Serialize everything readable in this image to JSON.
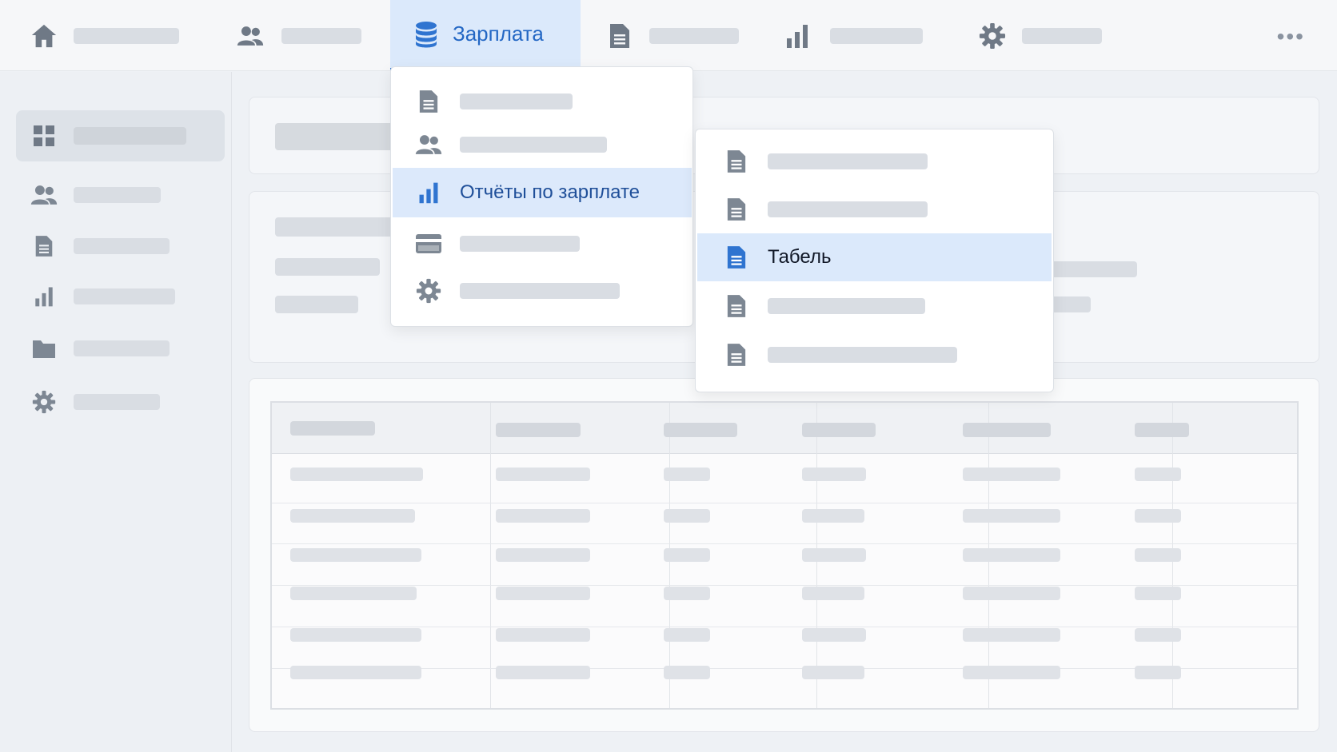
{
  "colors": {
    "accent": "#2f74d0",
    "active_bg": "#dce9fb",
    "icon_gray": "#7d8793",
    "placeholder": "#d9dde3"
  },
  "topnav": {
    "items": [
      {
        "icon": "home-icon",
        "label": ""
      },
      {
        "icon": "users-icon",
        "label": ""
      },
      {
        "icon": "database-icon",
        "label": "Зарплата",
        "active": true
      },
      {
        "icon": "document-icon",
        "label": ""
      },
      {
        "icon": "bar-chart-icon",
        "label": ""
      },
      {
        "icon": "gear-icon",
        "label": ""
      }
    ],
    "more_icon": "more-horizontal-icon",
    "more_glyph": "•••"
  },
  "sidebar": {
    "items": [
      {
        "icon": "dashboard-grid-icon",
        "label": "",
        "active": true
      },
      {
        "icon": "users-icon",
        "label": ""
      },
      {
        "icon": "document-icon",
        "label": ""
      },
      {
        "icon": "bar-chart-icon",
        "label": ""
      },
      {
        "icon": "folder-icon",
        "label": ""
      },
      {
        "icon": "gear-icon",
        "label": ""
      }
    ]
  },
  "dropdown": {
    "items": [
      {
        "icon": "document-icon",
        "label": ""
      },
      {
        "icon": "users-icon",
        "label": ""
      },
      {
        "icon": "bar-chart-icon",
        "label": "Отчёты по зарплате",
        "active": true
      },
      {
        "icon": "credit-card-icon",
        "label": ""
      },
      {
        "icon": "gear-icon",
        "label": ""
      }
    ]
  },
  "submenu": {
    "items": [
      {
        "icon": "document-icon",
        "label": ""
      },
      {
        "icon": "document-icon",
        "label": ""
      },
      {
        "icon": "document-icon",
        "label": "Табель",
        "active": true
      },
      {
        "icon": "document-icon",
        "label": ""
      },
      {
        "icon": "document-icon",
        "label": ""
      }
    ]
  },
  "table": {
    "columns": 6,
    "rows": 6
  }
}
